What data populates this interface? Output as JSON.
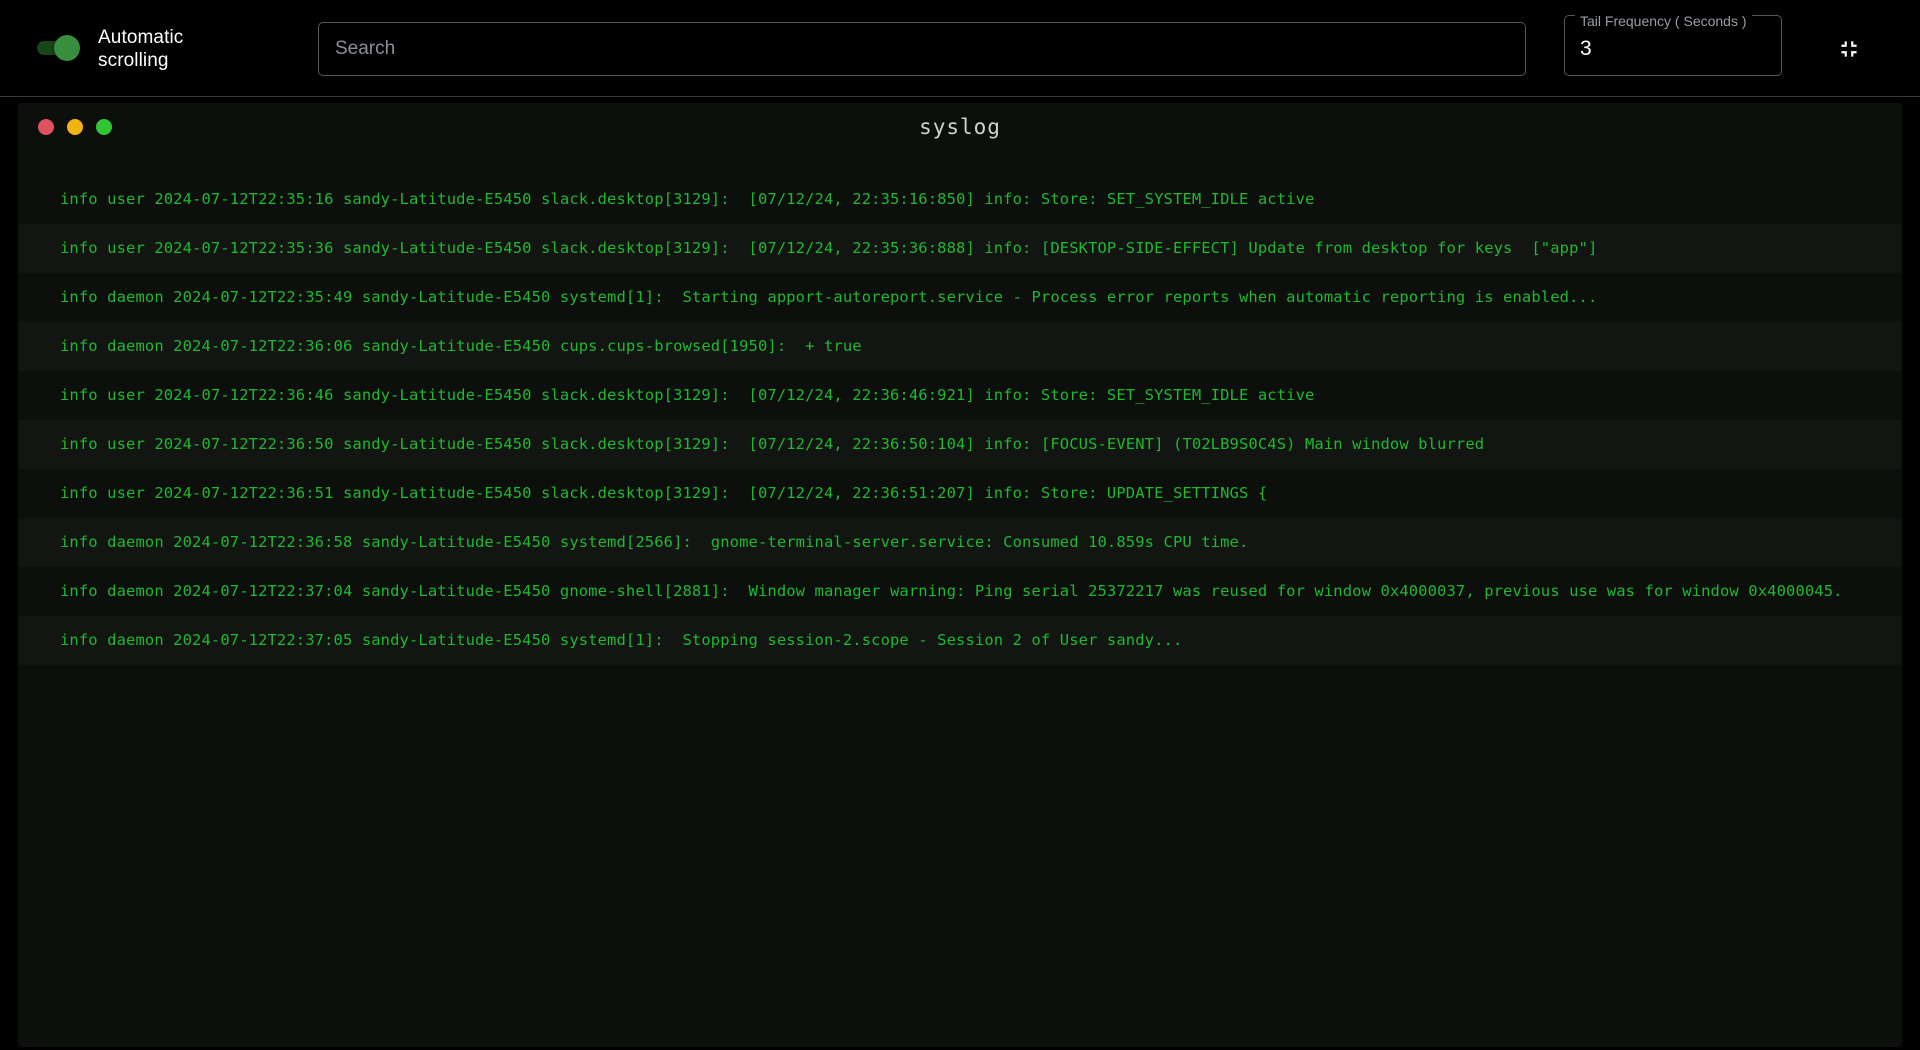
{
  "toolbar": {
    "auto_scroll_label": "Automatic scrolling",
    "auto_scroll_on": true,
    "search": {
      "placeholder": "Search",
      "value": ""
    },
    "tail_frequency": {
      "legend": "Tail Frequency ( Seconds )",
      "value": "3"
    },
    "collapse_icon": "fullscreen-exit-icon"
  },
  "log_window": {
    "title": "syslog",
    "traffic_lights": [
      {
        "name": "close-dot",
        "color": "#e05260"
      },
      {
        "name": "minimize-dot",
        "color": "#f1b412"
      },
      {
        "name": "maximize-dot",
        "color": "#2fc631"
      }
    ],
    "text_color": "#1fb82f",
    "lines": [
      "info user 2024-07-12T22:35:16 sandy-Latitude-E5450 slack.desktop[3129]:  [07/12/24, 22:35:16:850] info: Store: SET_SYSTEM_IDLE active",
      "info user 2024-07-12T22:35:36 sandy-Latitude-E5450 slack.desktop[3129]:  [07/12/24, 22:35:36:888] info: [DESKTOP-SIDE-EFFECT] Update from desktop for keys  [\"app\"]",
      "info daemon 2024-07-12T22:35:49 sandy-Latitude-E5450 systemd[1]:  Starting apport-autoreport.service - Process error reports when automatic reporting is enabled...",
      "info daemon 2024-07-12T22:36:06 sandy-Latitude-E5450 cups.cups-browsed[1950]:  + true",
      "info user 2024-07-12T22:36:46 sandy-Latitude-E5450 slack.desktop[3129]:  [07/12/24, 22:36:46:921] info: Store: SET_SYSTEM_IDLE active",
      "info user 2024-07-12T22:36:50 sandy-Latitude-E5450 slack.desktop[3129]:  [07/12/24, 22:36:50:104] info: [FOCUS-EVENT] (T02LB9S0C4S) Main window blurred",
      "info user 2024-07-12T22:36:51 sandy-Latitude-E5450 slack.desktop[3129]:  [07/12/24, 22:36:51:207] info: Store: UPDATE_SETTINGS {",
      "info daemon 2024-07-12T22:36:58 sandy-Latitude-E5450 systemd[2566]:  gnome-terminal-server.service: Consumed 10.859s CPU time.",
      "info daemon 2024-07-12T22:37:04 sandy-Latitude-E5450 gnome-shell[2881]:  Window manager warning: Ping serial 25372217 was reused for window 0x4000037, previous use was for window 0x4000045.",
      "info daemon 2024-07-12T22:37:05 sandy-Latitude-E5450 systemd[1]:  Stopping session-2.scope - Session 2 of User sandy..."
    ]
  }
}
